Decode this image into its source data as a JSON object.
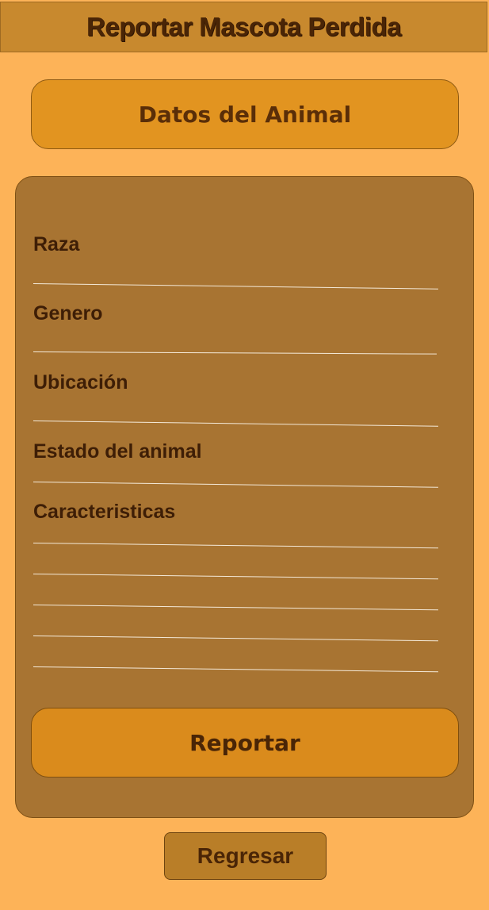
{
  "header": {
    "title": "Reportar Mascota Perdida"
  },
  "section": {
    "title": "Datos del Animal"
  },
  "form": {
    "fields": [
      {
        "label": "Raza",
        "value": ""
      },
      {
        "label": "Genero",
        "value": ""
      },
      {
        "label": "Ubicación",
        "value": ""
      },
      {
        "label": "Estado del animal",
        "value": ""
      },
      {
        "label": "Caracteristicas",
        "value": ""
      }
    ],
    "submit_label": "Reportar"
  },
  "footer": {
    "back_label": "Regresar"
  },
  "colors": {
    "background": "#FDB358",
    "header": "#C8892E",
    "accent": "#E29420",
    "card": "#A87432",
    "text": "#4A2506",
    "line": "#F4E9D8"
  }
}
